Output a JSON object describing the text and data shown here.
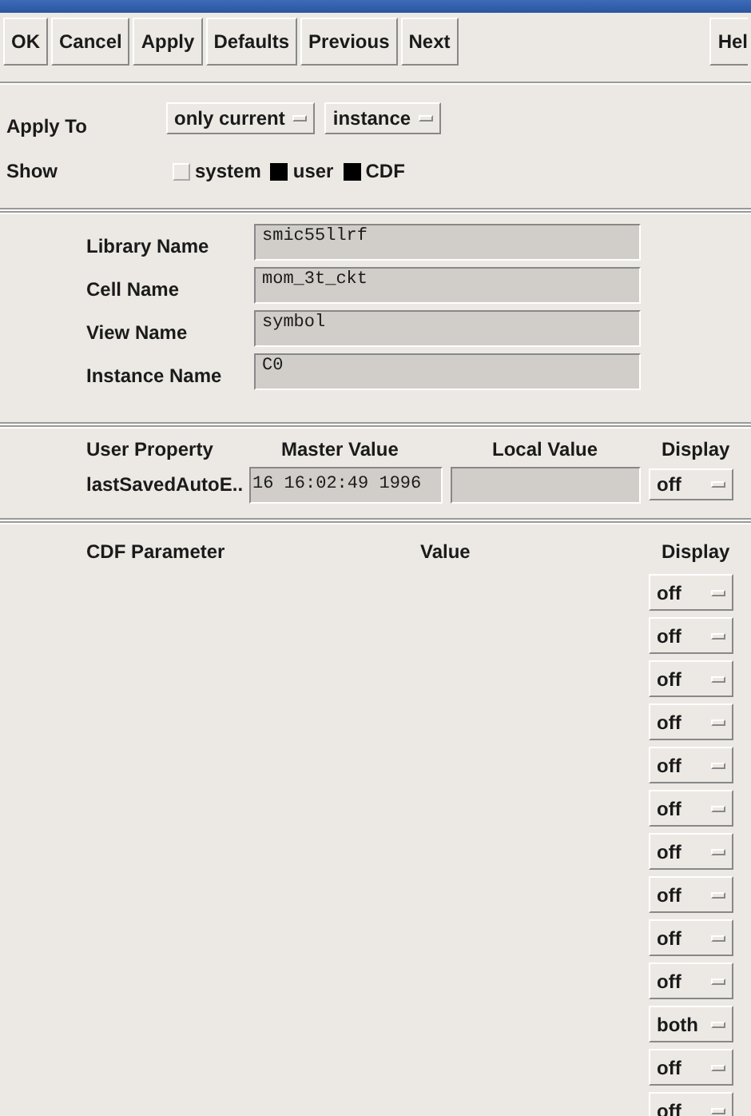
{
  "toolbar": {
    "buttons": [
      "OK",
      "Cancel",
      "Apply",
      "Defaults",
      "Previous",
      "Next"
    ],
    "help": "Hel"
  },
  "apply_to": {
    "label": "Apply To",
    "menus": [
      "only current",
      "instance"
    ]
  },
  "show": {
    "label": "Show",
    "options": [
      {
        "label": "system",
        "checked": false
      },
      {
        "label": "user",
        "checked": true
      },
      {
        "label": "CDF",
        "checked": true
      }
    ]
  },
  "names": [
    {
      "label": "Library Name",
      "value": "smic55llrf"
    },
    {
      "label": "Cell Name",
      "value": "mom_3t_ckt"
    },
    {
      "label": "View Name",
      "value": "symbol"
    },
    {
      "label": "Instance Name",
      "value": "C0"
    }
  ],
  "user_properties": {
    "columns": [
      "User Property",
      "Master Value",
      "Local Value",
      "Display"
    ],
    "rows": [
      {
        "name": "lastSavedAutoE..",
        "master": "16 16:02:49 1996",
        "display": "off"
      }
    ]
  },
  "cdf_parameters": {
    "columns": [
      "CDF Parameter",
      "Value",
      "Display"
    ],
    "displays": [
      "off",
      "off",
      "off",
      "off",
      "off",
      "off",
      "off",
      "off",
      "off",
      "off",
      "both",
      "off",
      "off"
    ]
  }
}
